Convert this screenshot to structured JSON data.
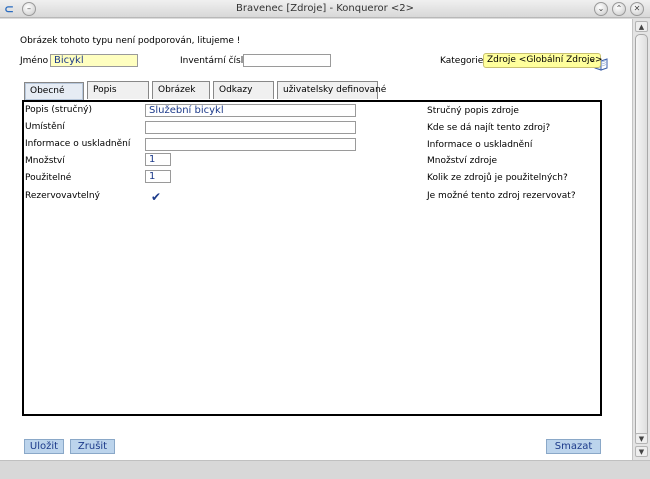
{
  "window": {
    "title": "Bravenec [Zdroje] - Konqueror <2>"
  },
  "message": "Obrázek tohoto typu není podporován, litujeme !",
  "header": {
    "name_label": "Jméno",
    "name_value": "Bicykl",
    "inventory_label": "Inventární číslo",
    "inventory_value": "",
    "category_label": "Kategorie",
    "category_value": "Zdroje <Globální Zdroje>"
  },
  "tabs": [
    {
      "label": "Obecné"
    },
    {
      "label": "Popis"
    },
    {
      "label": "Obrázek"
    },
    {
      "label": "Odkazy"
    },
    {
      "label": "uživatelsky definované"
    }
  ],
  "fields": [
    {
      "label": "Popis (stručný)",
      "value": "Služební bicykl",
      "help": "Stručný popis zdroje"
    },
    {
      "label": "Umístění",
      "value": "",
      "help": "Kde se dá najít tento zdroj?"
    },
    {
      "label": "Informace o uskladnění",
      "value": "",
      "help": "Informace o uskladnění"
    },
    {
      "label": "Množství",
      "value": "1",
      "help": "Množství zdroje"
    },
    {
      "label": "Použitelné",
      "value": "1",
      "help": "Kolik ze zdrojů je použitelných?"
    },
    {
      "label": "Rezervovavtelný",
      "value": "",
      "help": "Je možné tento zdroj rezervovat?"
    }
  ],
  "buttons": {
    "save": "Uložit",
    "cancel": "Zrušit",
    "delete": "Smazat"
  },
  "icons": {
    "app": "konqueror-logo-icon",
    "titlebar_left": "window-menu-icon",
    "minimize": "chevron-down-icon",
    "maximize": "chevron-up-icon",
    "close": "close-icon",
    "help": "book-icon",
    "checkbox": "checkmark-icon"
  },
  "colors": {
    "input_highlight": "#ffffc0",
    "select_background": "#ffff9c",
    "button_background": "#bcd4ec",
    "text_blue": "#1c3a8a"
  }
}
